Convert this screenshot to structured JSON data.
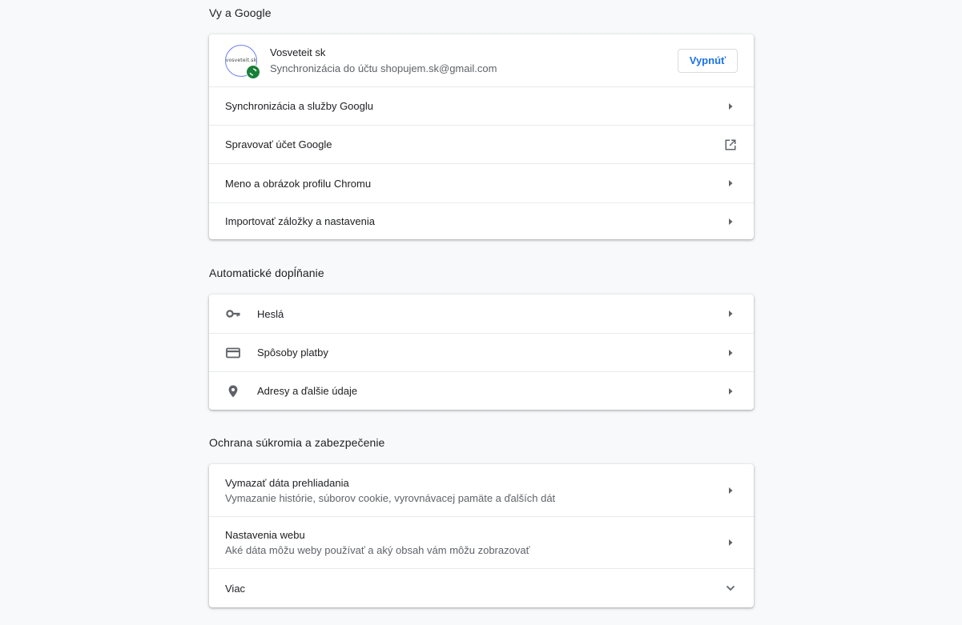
{
  "sections": {
    "you_and_google": {
      "title": "Vy a Google",
      "profile": {
        "avatar_text": "vosveteit.sk",
        "name": "Vosveteit sk",
        "sync_text": "Synchronizácia do účtu shopujem.sk@gmail.com",
        "turn_off_label": "Vypnúť"
      },
      "items": [
        {
          "label": "Synchronizácia a služby Googlu",
          "icon": "arrow-right-icon"
        },
        {
          "label": "Spravovať účet Google",
          "icon": "open-in-new-icon"
        },
        {
          "label": "Meno a obrázok profilu Chromu",
          "icon": "arrow-right-icon"
        },
        {
          "label": "Importovať záložky a nastavenia",
          "icon": "arrow-right-icon"
        }
      ]
    },
    "autofill": {
      "title": "Automatické dopĺňanie",
      "items": [
        {
          "label": "Heslá",
          "icon": "key-icon"
        },
        {
          "label": "Spôsoby platby",
          "icon": "credit-card-icon"
        },
        {
          "label": "Adresy a ďalšie údaje",
          "icon": "location-pin-icon"
        }
      ]
    },
    "privacy": {
      "title": "Ochrana súkromia a zabezpečenie",
      "items": [
        {
          "label": "Vymazať dáta prehliadania",
          "sublabel": "Vymazanie histórie, súborov cookie, vyrovnávacej pamäte a ďalších dát"
        },
        {
          "label": "Nastavenia webu",
          "sublabel": "Aké dáta môžu weby používať a aký obsah vám môžu zobrazovať"
        },
        {
          "label": "Viac",
          "icon": "chevron-down-icon"
        }
      ]
    }
  },
  "colors": {
    "background": "#f8f9fa",
    "accent": "#1a73e8",
    "sync_green": "#188038",
    "icon_gray": "#5f6368"
  }
}
